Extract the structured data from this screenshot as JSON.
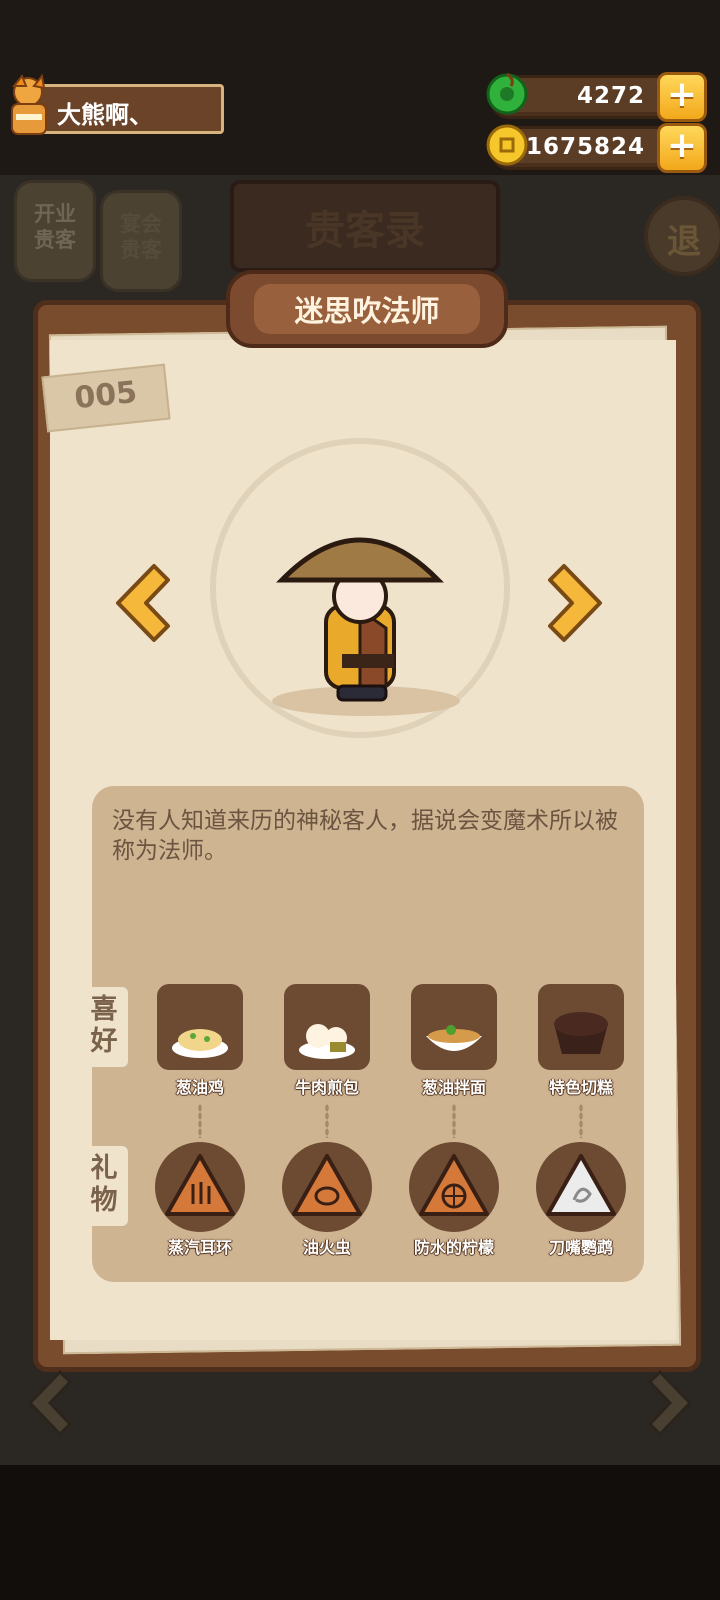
{
  "header": {
    "player_name": "大熊啊、",
    "gems": "4272",
    "coins": "1675824"
  },
  "background": {
    "title": "贵客录",
    "tab_open": "开业贵客",
    "tab_other": "宴会贵客",
    "exit_label": "退"
  },
  "guest": {
    "name": "迷思吹法师",
    "number": "005",
    "description": "没有人知道来历的神秘客人，据说会变魔术所以被称为法师。"
  },
  "sections": {
    "likes_label": "喜好",
    "gifts_label": "礼物"
  },
  "likes": [
    {
      "name": "葱油鸡"
    },
    {
      "name": "牛肉煎包"
    },
    {
      "name": "葱油拌面"
    },
    {
      "name": "特色切糕"
    }
  ],
  "gifts": [
    {
      "name": "蒸汽耳环"
    },
    {
      "name": "油火虫"
    },
    {
      "name": "防水的柠檬"
    },
    {
      "name": "刀嘴鹦鹉"
    }
  ],
  "colors": {
    "card_frame": "#7a4c2e",
    "paper": "#efe3cc",
    "panel": "#cfb492",
    "accent_gold": "#f2a81b"
  },
  "icons": {
    "gem": "green-jade-icon",
    "coin": "gold-coin-icon",
    "plus": "plus-icon",
    "prev": "chevron-left-icon",
    "next": "chevron-right-icon"
  }
}
